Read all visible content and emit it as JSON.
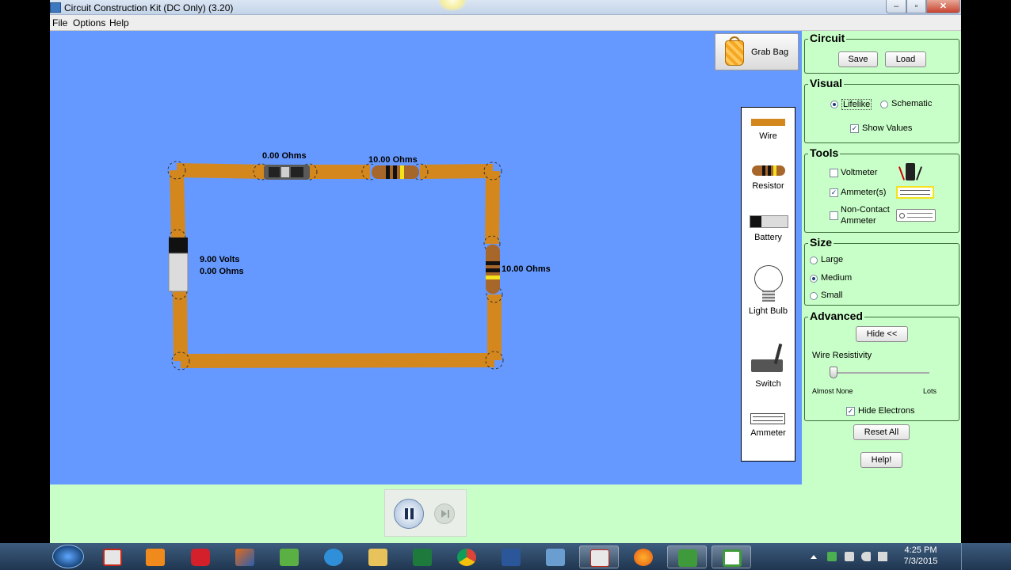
{
  "window": {
    "title": "Circuit Construction Kit (DC Only) (3.20)",
    "min": "–",
    "max": "▫",
    "close": "✕"
  },
  "menu": [
    "File",
    "Options",
    "Help"
  ],
  "grab_bag": {
    "label": "Grab Bag"
  },
  "circuit_labels": {
    "top_left_resistor": "0.00 Ohms",
    "top_right_resistor": "10.00 Ohms",
    "battery_volts": "9.00 Volts",
    "battery_ohms": "0.00 Ohms",
    "right_resistor": "10.00 Ohms"
  },
  "toolbox": {
    "wire": "Wire",
    "resistor": "Resistor",
    "battery": "Battery",
    "light_bulb": "Light Bulb",
    "switch": "Switch",
    "ammeter": "Ammeter"
  },
  "panel": {
    "circuit": {
      "title": "Circuit",
      "save": "Save",
      "load": "Load"
    },
    "visual": {
      "title": "Visual",
      "lifelike": "Lifelike",
      "schematic": "Schematic",
      "selected": "Lifelike",
      "show_values": "Show Values",
      "show_values_checked": true
    },
    "tools": {
      "title": "Tools",
      "voltmeter": "Voltmeter",
      "voltmeter_checked": false,
      "ammeters": "Ammeter(s)",
      "ammeters_checked": true,
      "non_contact_1": "Non-Contact",
      "non_contact_2": "Ammeter",
      "non_contact_checked": false
    },
    "size": {
      "title": "Size",
      "large": "Large",
      "medium": "Medium",
      "small": "Small",
      "selected": "Medium"
    },
    "advanced": {
      "title": "Advanced",
      "hide": "Hide <<",
      "wire_resistivity": "Wire Resistivity",
      "almost_none": "Almost None",
      "lots": "Lots",
      "resistivity_level": 0.0,
      "hide_electrons": "Hide Electrons",
      "hide_electrons_checked": true
    },
    "reset_all": "Reset All",
    "help": "Help!"
  },
  "playback": {
    "pause": "pause",
    "step": "step"
  },
  "taskbar": {
    "clock_time": "4:25 PM",
    "clock_date": "7/3/2015"
  },
  "colors": {
    "canvas": "#6699ff",
    "wire": "#d4871c",
    "panel": "#c8ffc8"
  }
}
